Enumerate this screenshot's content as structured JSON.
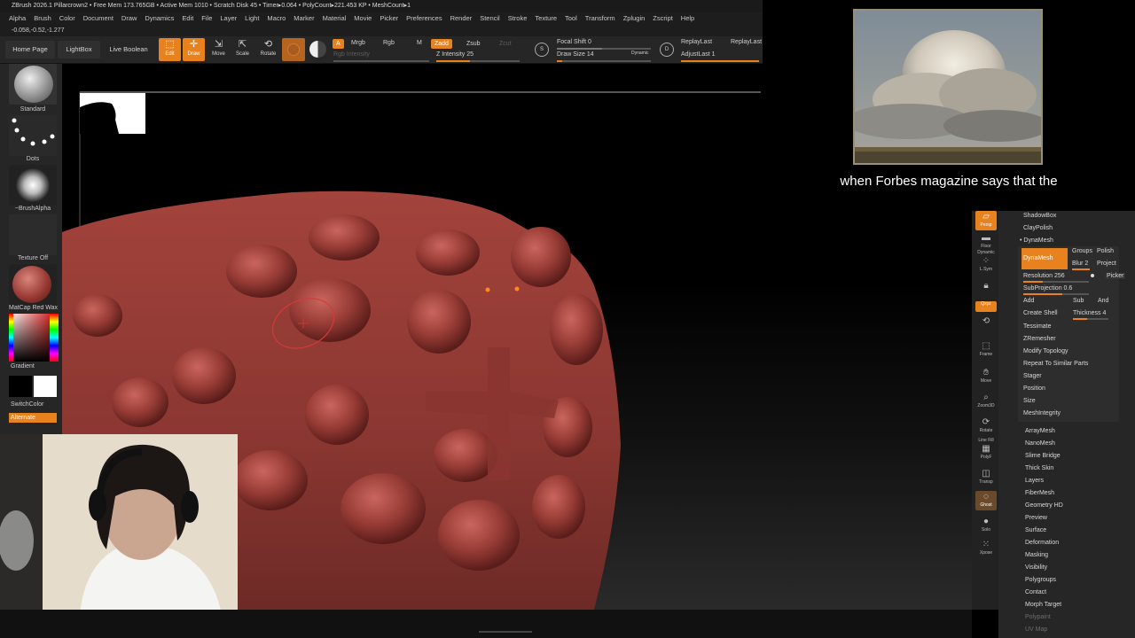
{
  "app": {
    "title_line": "ZBrush 2026.1   Pillarcrown2   • Free Mem 173.765GB • Active Mem 1010 • Scratch Disk 45 •  Timer▸0.064 • PolyCount▸221.453 KP • MeshCount▸1",
    "coords": "-0.058,-0.52,-1.277"
  },
  "menubar": [
    "Alpha",
    "Brush",
    "Color",
    "Document",
    "Draw",
    "Dynamics",
    "Edit",
    "File",
    "Layer",
    "Light",
    "Macro",
    "Marker",
    "Material",
    "Movie",
    "Picker",
    "Preferences",
    "Render",
    "Stencil",
    "Stroke",
    "Texture",
    "Tool",
    "Transform",
    "Zplugin",
    "Zscript",
    "Help"
  ],
  "toolbar": {
    "home_page": "Home Page",
    "lightbox": "LightBox",
    "live_boolean": "Live Boolean",
    "edit": "Edit",
    "draw": "Draw",
    "move": "Move",
    "scale": "Scale",
    "rotate": "Rotate",
    "a_chip": "A",
    "mrgb": "Mrgb",
    "rgb": "Rgb",
    "m": "M",
    "zadd": "Zadd",
    "zsub": "Zsub",
    "zcut": "Zcut",
    "rgb_intensity": "Rgb Intensity",
    "z_intensity": "Z Intensity 25",
    "focal_shift": "Focal Shift 0",
    "draw_size": "Draw Size 14",
    "dynamic": "Dynamic",
    "replay_last": "ReplayLast",
    "replay_last_rel": "ReplayLast",
    "adjust_last": "AdjustLast 1",
    "s_key": "S",
    "d_key": "D"
  },
  "leftshelf": {
    "standard": "Standard",
    "dots": "Dots",
    "brush_alpha": "~BrushAlpha",
    "texture_off": "Texture Off",
    "matcap": "MatCap Red Wax",
    "gradient": "Gradient",
    "switch_color": "SwitchColor",
    "alternate": "Alternate"
  },
  "iconstrip": {
    "persp": "Persp",
    "floor": "Floor",
    "dynamic": "Dynamic",
    "lsym": "L.Sym",
    "qxyz": "Qxyz",
    "frame": "Frame",
    "move": "Move",
    "zoom3d": "Zoom3D",
    "rotate": "Rotate",
    "line_fill": "Line Fill",
    "polyf": "PolyF",
    "transp": "Transp",
    "ghost": "Ghost",
    "solo": "Solo",
    "xpose": "Xpose"
  },
  "rightpanel": {
    "shadowbox": "ShadowBox",
    "claypolish": "ClayPolish",
    "dynamesh_header": "DynaMesh",
    "dynamesh_btn": "DynaMesh",
    "groups": "Groups",
    "polish": "Polish",
    "blur": "Blur",
    "blur_val": "2",
    "project": "Project",
    "resolution": "Resolution 256",
    "picker": "Picker",
    "subprojection": "SubProjection 0.6",
    "add": "Add",
    "sub": "Sub",
    "and": "And",
    "create_shell": "Create Shell",
    "thickness": "Thickness 4",
    "tessimate": "Tessimate",
    "zremesher": "ZRemesher",
    "modify_topology": "Modify Topology",
    "repeat_similar": "Repeat To Similar Parts",
    "stager": "Stager",
    "position": "Position",
    "size": "Size",
    "meshintegrity": "MeshIntegrity",
    "sections": [
      "ArrayMesh",
      "NanoMesh",
      "Slime Bridge",
      "Thick Skin",
      "Layers",
      "FiberMesh",
      "Geometry HD",
      "Preview",
      "Surface",
      "Deformation",
      "Masking",
      "Visibility",
      "Polygroups",
      "Contact",
      "Morph Target"
    ],
    "dim_sections": [
      "Polypaint",
      "UV Map"
    ]
  },
  "caption": "when Forbes magazine says that the",
  "colors": {
    "accent": "#e8821f",
    "clay": "#8e3a36",
    "panel": "#262626"
  }
}
